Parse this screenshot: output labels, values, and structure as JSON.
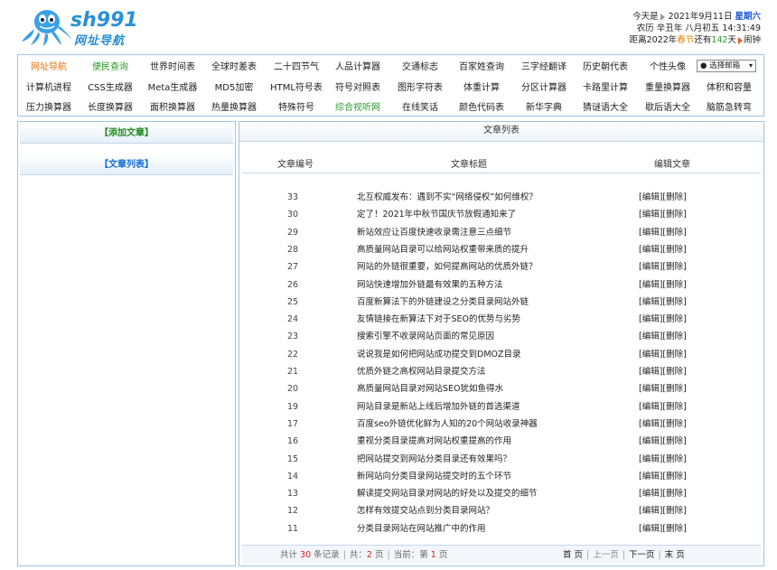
{
  "header": {
    "logo_top": "sh991",
    "logo_bottom": "网址导航",
    "today_label": "今天是",
    "date": "2021年9月11日",
    "weekday": "星期六",
    "lunar_label": "农历",
    "lunar_date": "辛丑年 八月初五",
    "time": "14:31:49",
    "countdown_pre": "距离2022年",
    "countdown_fest": "春节",
    "countdown_mid": "还有",
    "countdown_days": "142",
    "countdown_unit": "天",
    "clock_label": "闹钟"
  },
  "nav": {
    "rows": [
      [
        "网址导航",
        "便民查询",
        "世界时间表",
        "全球时差表",
        "二十四节气",
        "人品计算器",
        "交通标志",
        "百家姓查询",
        "三字经翻译",
        "历史朝代表",
        "个性头像"
      ],
      [
        "计算机进程",
        "CSS生成器",
        "Meta生成器",
        "MD5加密",
        "HTML符号表",
        "符号对照表",
        "图形字符表",
        "体重计算",
        "分区计算器",
        "卡路里计算",
        "重量换算器",
        "体积和容量"
      ],
      [
        "压力换算器",
        "长度换算器",
        "面积换算器",
        "热量换算器",
        "特殊符号",
        "综合视听网",
        "在线笑话",
        "颜色代码表",
        "新华字典",
        "猜谜语大全",
        "歇后语大全",
        "脑筋急转弯"
      ]
    ],
    "select_label": "● 选择邮箱",
    "select_arrow": "▾"
  },
  "left": {
    "add_article": "【添加文章】",
    "article_list": "【文章列表】"
  },
  "right": {
    "title": "文章列表",
    "col_id": "文章编号",
    "col_title": "文章标题",
    "col_edit": "编辑文章",
    "edit_label": "[编辑]",
    "delete_label": "[删除]",
    "rows": [
      {
        "id": "33",
        "title": "北互权威发布：遇到不实“网络侵权”如何维权？"
      },
      {
        "id": "30",
        "title": "定了！2021年中秋节国庆节放假通知来了"
      },
      {
        "id": "29",
        "title": "新站效应让百度快速收录需注意三点细节"
      },
      {
        "id": "28",
        "title": "高质量网站目录可以给网站权重带来质的提升"
      },
      {
        "id": "27",
        "title": "网站的外链很重要，如何提高网站的优质外链？"
      },
      {
        "id": "26",
        "title": "网站快速增加外链最有效果的五种方法"
      },
      {
        "id": "25",
        "title": "百度新算法下的外链建设之分类目录网站外链"
      },
      {
        "id": "24",
        "title": "友情链接在新算法下对于SEO的优势与劣势"
      },
      {
        "id": "23",
        "title": "搜索引擎不收录网站页面的常见原因"
      },
      {
        "id": "22",
        "title": "说说我是如何把网站成功提交到DMOZ目录"
      },
      {
        "id": "21",
        "title": "优质外链之高权网站目录提交方法"
      },
      {
        "id": "20",
        "title": "高质量网站目录对网站SEO犹如鱼得水"
      },
      {
        "id": "19",
        "title": "网站目录是新站上线后增加外链的首选渠道"
      },
      {
        "id": "17",
        "title": "百度seo外链优化鲜为人知的20个网站收录神器"
      },
      {
        "id": "16",
        "title": "重视分类目录提高对网站权重提高的作用"
      },
      {
        "id": "15",
        "title": "把网站提交到网站分类目录还有效果吗？"
      },
      {
        "id": "14",
        "title": "新网站向分类目录网站提交时的五个环节"
      },
      {
        "id": "13",
        "title": "解读提交网站目录对网站的好处以及提交的细节"
      },
      {
        "id": "12",
        "title": "怎样有效提交站点到分类目录网站？"
      },
      {
        "id": "11",
        "title": "分类目录网站在网站推广中的作用"
      }
    ],
    "pager": {
      "total_pre": "共计",
      "total_count": "30",
      "total_post": "条记录",
      "pages_pre": "共：",
      "pages_count": "2",
      "pages_post": "页",
      "current_pre": "当前：第",
      "current_page": "1",
      "current_post": "页",
      "first": "首 页",
      "prev": "上一页",
      "next": "下一页",
      "last": "末 页"
    }
  }
}
